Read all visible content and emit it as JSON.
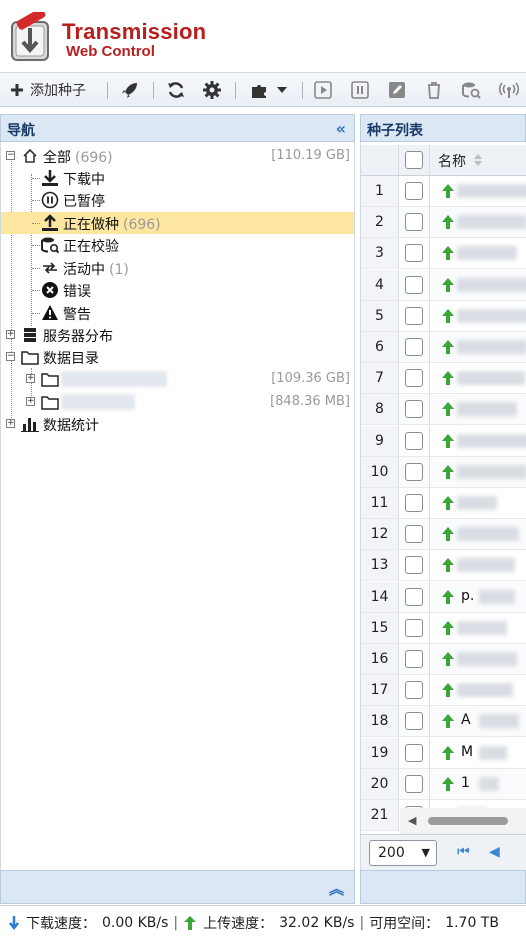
{
  "app": {
    "title": "Transmission",
    "subtitle": "Web Control"
  },
  "toolbar": {
    "add_label": "添加种子",
    "buttons": [
      "rocket-icon",
      "refresh-icon",
      "gear-icon",
      "plugin-icon",
      "start-icon",
      "pause-icon",
      "edit-icon",
      "delete-icon",
      "check-icon",
      "tracker-icon"
    ]
  },
  "nav": {
    "title": "导航",
    "items": [
      {
        "label": "全部",
        "count": "(696)",
        "size": "[110.19 GB]",
        "icon": "home-icon"
      },
      {
        "label": "下载中",
        "count": "",
        "icon": "download-icon"
      },
      {
        "label": "已暂停",
        "count": "",
        "icon": "pause-circle-icon"
      },
      {
        "label": "正在做种",
        "count": "(696)",
        "icon": "upload-icon"
      },
      {
        "label": "正在校验",
        "count": "",
        "icon": "verify-icon"
      },
      {
        "label": "活动中",
        "count": "(1)",
        "icon": "active-icon"
      },
      {
        "label": "错误",
        "count": "",
        "icon": "error-icon"
      },
      {
        "label": "警告",
        "count": "",
        "icon": "warning-icon"
      },
      {
        "label": "服务器分布",
        "count": "",
        "icon": "server-icon"
      },
      {
        "label": "数据目录",
        "count": "",
        "icon": "folder-icon"
      },
      {
        "label": "",
        "size": "[109.36 GB]",
        "icon": "folder-icon"
      },
      {
        "label": "",
        "size": "[848.36 MB]",
        "icon": "folder-icon"
      },
      {
        "label": "数据统计",
        "count": "",
        "icon": "chart-icon"
      }
    ]
  },
  "torrents": {
    "title": "种子列表",
    "col_name": "名称",
    "rows": [
      {
        "n": "1",
        "name": ""
      },
      {
        "n": "2",
        "name": ""
      },
      {
        "n": "3",
        "name": ""
      },
      {
        "n": "4",
        "name": ""
      },
      {
        "n": "5",
        "name": ""
      },
      {
        "n": "6",
        "name": ""
      },
      {
        "n": "7",
        "name": ""
      },
      {
        "n": "8",
        "name": ""
      },
      {
        "n": "9",
        "name": ""
      },
      {
        "n": "10",
        "name": ""
      },
      {
        "n": "11",
        "name": ""
      },
      {
        "n": "12",
        "name": ""
      },
      {
        "n": "13",
        "name": ""
      },
      {
        "n": "14",
        "name": "p."
      },
      {
        "n": "15",
        "name": ""
      },
      {
        "n": "16",
        "name": ""
      },
      {
        "n": "17",
        "name": ""
      },
      {
        "n": "18",
        "name": "A"
      },
      {
        "n": "19",
        "name": "M"
      },
      {
        "n": "20",
        "name": "1"
      },
      {
        "n": "21",
        "name": ""
      }
    ],
    "page_size": "200"
  },
  "status": {
    "download_label": "下载速度：",
    "download_value": "0.00 KB/s",
    "upload_label": "上传速度：",
    "upload_value": "32.02 KB/s",
    "free_label": "可用空间：",
    "free_value": "1.70 TB"
  }
}
